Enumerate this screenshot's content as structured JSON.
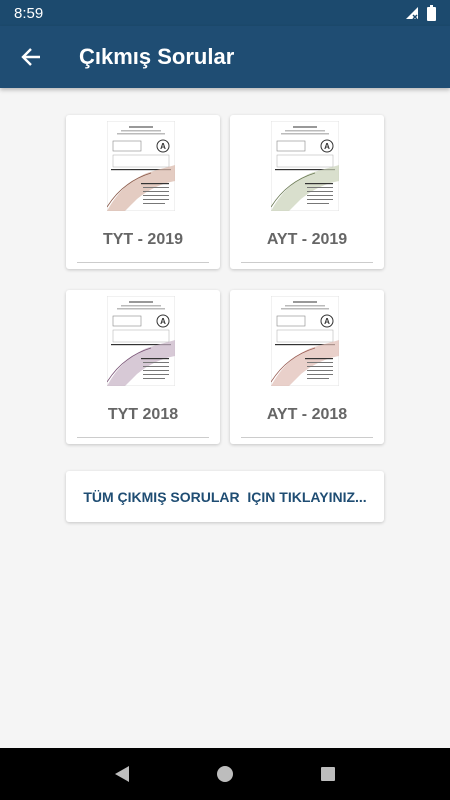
{
  "status_bar": {
    "time": "8:59"
  },
  "app_bar": {
    "title": "Çıkmış Sorular"
  },
  "exams": [
    {
      "label": "TYT - 2019"
    },
    {
      "label": "AYT - 2019"
    },
    {
      "label": "TYT 2018"
    },
    {
      "label": "AYT - 2018"
    }
  ],
  "all_questions_button": {
    "label": "TÜM ÇIKMIŞ SORULAR  IÇIN TIKLAYINIZ..."
  },
  "colors": {
    "status_bar": "#1c4a6e",
    "app_bar": "#1f4d73",
    "accent_text": "#1f4d73",
    "label_gray": "#666666"
  }
}
